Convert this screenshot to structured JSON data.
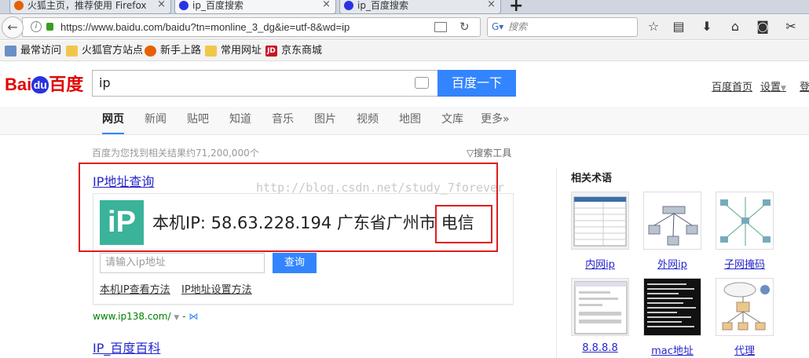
{
  "browser": {
    "tabs": [
      {
        "label": "火狐主页，推荐使用 Firefox"
      },
      {
        "label": "ip_百度搜索"
      },
      {
        "label": "ip_百度搜索"
      }
    ],
    "new_tab_glyph": "+",
    "url": "https://www.baidu.com/baidu?tn=monline_3_dg&ie=utf-8&wd=ip",
    "search_placeholder": "搜索",
    "bookmarks": [
      {
        "label": "最常访问",
        "icon": "gear-icon"
      },
      {
        "label": "火狐官方站点",
        "icon": "folder-icon"
      },
      {
        "label": "新手上路",
        "icon": "firefox-icon"
      },
      {
        "label": "常用网址",
        "icon": "folder-icon"
      },
      {
        "label": "京东商城",
        "icon": "jd-icon",
        "icon_text": "JD"
      }
    ]
  },
  "baidu": {
    "logo_text_left": "Bai",
    "logo_text_paw": "du",
    "logo_text_right": "百度",
    "search_value": "ip",
    "search_button": "百度一下",
    "top_links": [
      "百度首页",
      "设置",
      "登"
    ],
    "nav_tabs": [
      "网页",
      "新闻",
      "贴吧",
      "知道",
      "音乐",
      "图片",
      "视频",
      "地图",
      "文库",
      "更多»"
    ],
    "result_count": "百度为您找到相关结果约71,200,000个",
    "search_tools": "搜索工具"
  },
  "result1": {
    "title": "IP地址查询",
    "icon_text": "iP",
    "ip_line": "本机IP: 58.63.228.194  广东省广州市 电信",
    "input_placeholder": "请输入ip地址",
    "query_button": "查询",
    "links": [
      "本机IP查看方法",
      "IP地址设置方法"
    ],
    "green_url": "www.ip138.com/"
  },
  "result2": {
    "title": "IP_百度百科"
  },
  "watermark": "http://blog.csdn.net/study_7forever",
  "related": {
    "title": "相关术语",
    "items": [
      {
        "label": "内网ip"
      },
      {
        "label": "外网ip"
      },
      {
        "label": "子网掩码"
      },
      {
        "label": "8.8.8.8"
      },
      {
        "label": "mac地址"
      },
      {
        "label": "代理"
      }
    ]
  },
  "colors": {
    "accent": "#3385ff",
    "link": "#2626cc",
    "highlight_box": "#e01d1d",
    "ip_icon": "#3ab39a"
  }
}
